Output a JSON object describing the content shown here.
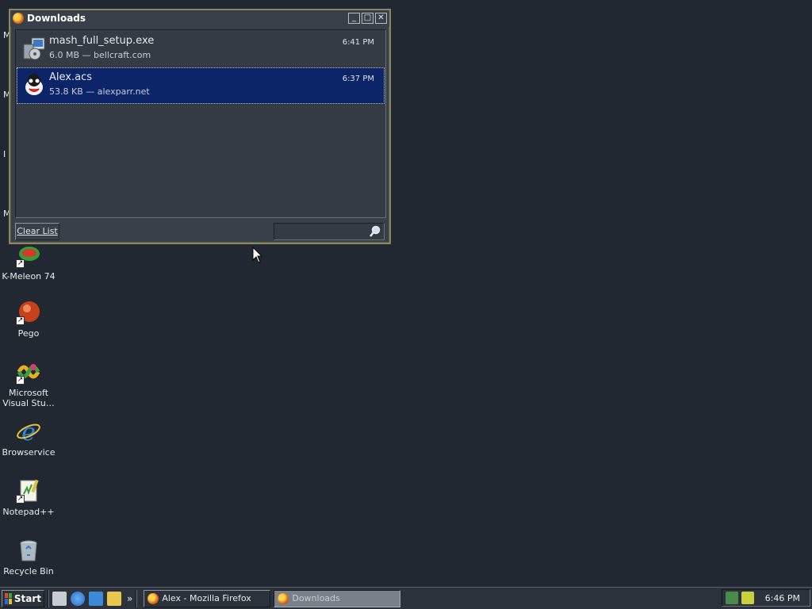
{
  "desktop": {
    "partial_labels": [
      "M",
      "M",
      "I",
      "M"
    ],
    "icons": [
      {
        "label": "K-Meleon 74",
        "icon": "k-meleon-icon"
      },
      {
        "label": "Pego",
        "icon": "pego-icon"
      },
      {
        "label": "Microsoft Visual Stu…",
        "icon": "visual-studio-icon"
      },
      {
        "label": "Browservice",
        "icon": "internet-explorer-icon"
      },
      {
        "label": "Notepad++",
        "icon": "notepad-plus-plus-icon"
      },
      {
        "label": "Recycle Bin",
        "icon": "recycle-bin-icon"
      }
    ]
  },
  "downloads_window": {
    "title": "Downloads",
    "items": [
      {
        "name": "mash_full_setup.exe",
        "meta": "6.0 MB — bellcraft.com",
        "time": "6:41 PM",
        "icon": "installer-icon",
        "selected": false
      },
      {
        "name": "Alex.acs",
        "meta": "53.8 KB — alexparr.net",
        "time": "6:37 PM",
        "icon": "alex-character-icon",
        "selected": true
      }
    ],
    "clear_list_label": "Clear List",
    "search_placeholder": ""
  },
  "taskbar": {
    "start_label": "Start",
    "quick_launch_overflow": "»",
    "tasks": [
      {
        "label": "Alex - Mozilla Firefox",
        "active": false
      },
      {
        "label": "Downloads",
        "active": true
      }
    ],
    "clock": "6:46 PM"
  },
  "colors": {
    "desktop_bg": "#222831",
    "window_border": "#8a8860",
    "selection": "#0c2468"
  }
}
